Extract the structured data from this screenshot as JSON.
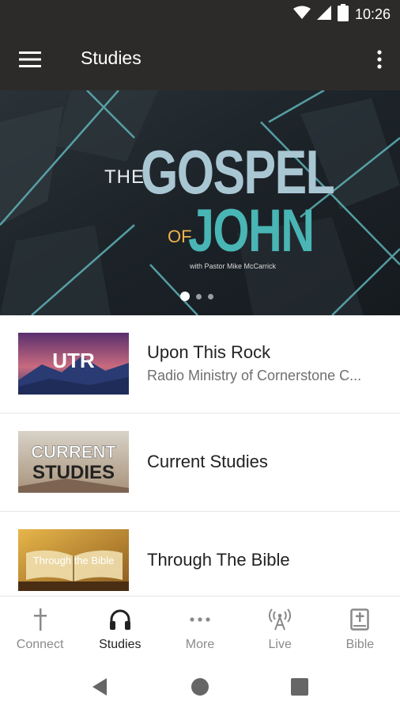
{
  "status_bar": {
    "time": "10:26",
    "icons": [
      "wifi-icon",
      "cell-signal-icon",
      "battery-icon"
    ]
  },
  "app_bar": {
    "title": "Studies",
    "menu_icon": "hamburger-menu-icon",
    "overflow_icon": "more-vertical-icon"
  },
  "hero": {
    "line_the": "THE",
    "line_gospel": "GOSPEL",
    "line_of": "OF",
    "line_john": "JOHN",
    "subtitle": "with Pastor Mike McCarrick",
    "pages": 3,
    "active_page": 1
  },
  "studies": [
    {
      "title": "Upon This Rock",
      "subtitle": "Radio Ministry of Cornerstone C...",
      "thumb_text": "UTR"
    },
    {
      "title": "Current Studies",
      "subtitle": "",
      "thumb_text_1": "CURRENT",
      "thumb_text_2": "STUDIES"
    },
    {
      "title": "Through The Bible",
      "subtitle": "",
      "thumb_text": "Through the Bible"
    }
  ],
  "bottom_nav": [
    {
      "label": "Connect",
      "icon": "cross-icon",
      "active": false
    },
    {
      "label": "Studies",
      "icon": "headphones-icon",
      "active": true
    },
    {
      "label": "More",
      "icon": "more-horizontal-icon",
      "active": false
    },
    {
      "label": "Live",
      "icon": "broadcast-tower-icon",
      "active": false
    },
    {
      "label": "Bible",
      "icon": "bible-icon",
      "active": false
    }
  ],
  "system_nav": [
    "back-icon",
    "home-icon",
    "recents-icon"
  ],
  "colors": {
    "app_bar": "#2d2b29",
    "teal": "#49b5b5",
    "light_blue": "#a9c6d3",
    "orange": "#f0b34a"
  }
}
